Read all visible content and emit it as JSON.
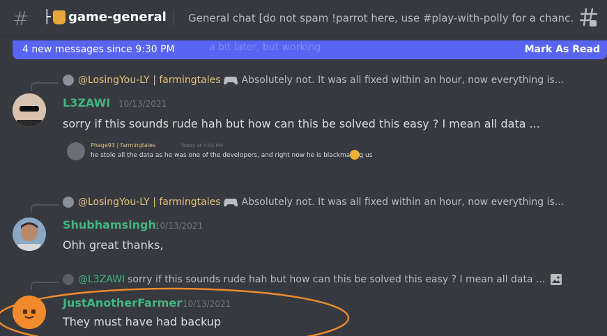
{
  "header": {
    "channel_prefix": "├",
    "channel_name": "game-general",
    "topic": "General chat [do not spam !parrot here, use #play-with-polly for a chanc..."
  },
  "banner": {
    "text": "4 new messages since 9:30 PM",
    "ghost_text": "a bit later, but working",
    "action": "Mark As Read"
  },
  "messages": [
    {
      "reply": {
        "author": "@LosingYou-LY | farmingtales",
        "text": "Absolutely not. It was all fixed within an hour, now everything is..."
      },
      "author": "L3ZAWI",
      "timestamp": "10/13/2021",
      "text": "sorry if this sounds rude hah but how can this be solved this easy ? I mean all data ...",
      "embed": {
        "author": "Phage93 | farmingtales",
        "time": "Today at 5:54 PM",
        "text": "he stole all the data as he was one of the developers, and right now he is blackmailing us"
      }
    },
    {
      "reply": {
        "author": "@LosingYou-LY | farmingtales",
        "text": "Absolutely not. It was all fixed within an hour, now everything is..."
      },
      "author": "Shubhamsingh",
      "timestamp": "10/13/2021",
      "text": "Ohh great thanks,"
    },
    {
      "reply": {
        "author": "@L3ZAWI",
        "text": "sorry if this sounds rude hah but how can this be solved this easy ? I mean all data ..."
      },
      "author": "JustAnotherFarmer",
      "timestamp": "10/13/2021",
      "text": "They must have had backup"
    }
  ],
  "colors": {
    "background": "#36393f",
    "banner": "#5865f2",
    "username_green": "#43b581",
    "reply_author_gold": "#e5c07b",
    "highlight_orange": "#f08a2c"
  }
}
